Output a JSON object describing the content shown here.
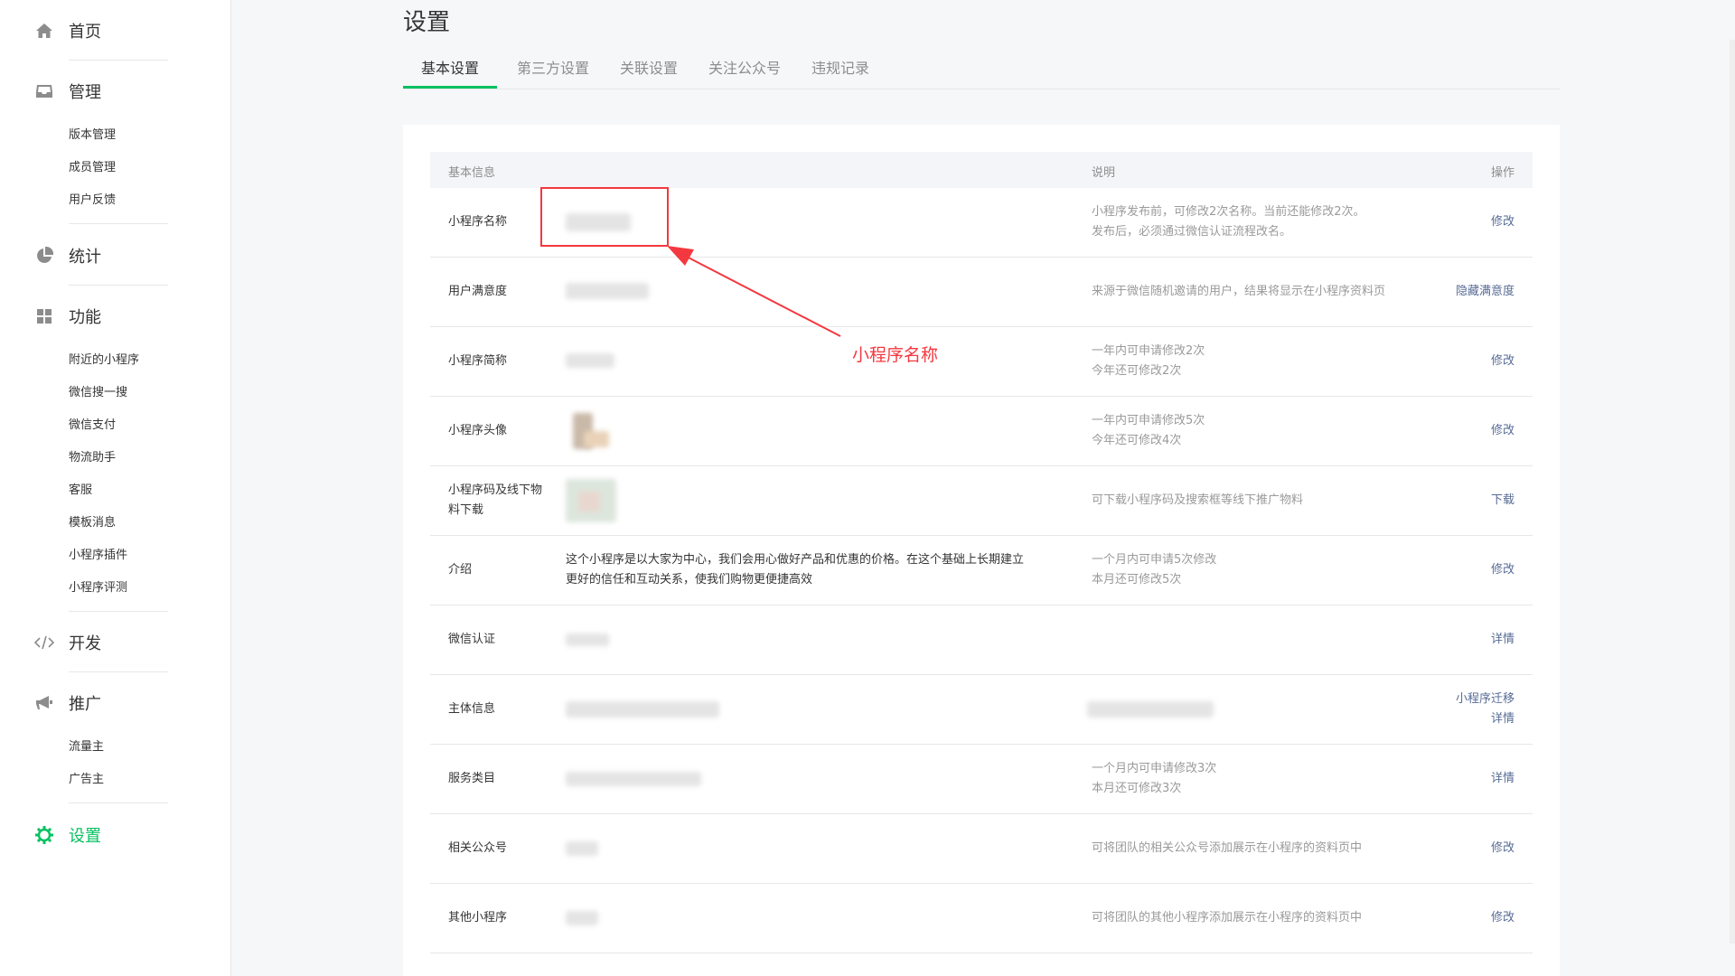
{
  "sidebar": {
    "home": "首页",
    "manage": "管理",
    "manage_items": [
      "版本管理",
      "成员管理",
      "用户反馈"
    ],
    "stats": "统计",
    "features": "功能",
    "feature_items": [
      "附近的小程序",
      "微信搜一搜",
      "微信支付",
      "物流助手",
      "客服",
      "模板消息",
      "小程序插件",
      "小程序评测"
    ],
    "develop": "开发",
    "promote": "推广",
    "promote_items": [
      "流量主",
      "广告主"
    ],
    "settings": "设置"
  },
  "page": {
    "title": "设置",
    "tabs": [
      "基本设置",
      "第三方设置",
      "关联设置",
      "关注公众号",
      "违规记录"
    ]
  },
  "table": {
    "headers": {
      "info": "基本信息",
      "desc": "说明",
      "op": "操作"
    },
    "rows": [
      {
        "label": "小程序名称",
        "desc1": "小程序发布前，可修改2次名称。当前还能修改2次。",
        "desc2": "发布后，必须通过微信认证流程改名。",
        "op1": "修改"
      },
      {
        "label": "用户满意度",
        "desc1": "来源于微信随机邀请的用户，结果将显示在小程序资料页",
        "op1": "隐藏满意度"
      },
      {
        "label": "小程序简称",
        "desc1": "一年内可申请修改2次",
        "desc2": "今年还可修改2次",
        "op1": "修改"
      },
      {
        "label": "小程序头像",
        "desc1": "一年内可申请修改5次",
        "desc2": "今年还可修改4次",
        "op1": "修改"
      },
      {
        "label": "小程序码及线下物",
        "label2": "料下载",
        "desc1": "可下载小程序码及搜索框等线下推广物料",
        "op1": "下载"
      },
      {
        "label": "介绍",
        "value1": "这个小程序是以大家为中心，我们会用心做好产品和优惠的价格。在这个基础上长期建立",
        "value2": "更好的信任和互动关系，使我们购物更便捷高效",
        "desc1": "一个月内可申请5次修改",
        "desc2": "本月还可修改5次",
        "op1": "修改"
      },
      {
        "label": "微信认证",
        "op1": "详情"
      },
      {
        "label": "主体信息",
        "op1": "小程序迁移",
        "op2": "详情"
      },
      {
        "label": "服务类目",
        "desc1": "一个月内可申请修改3次",
        "desc2": "本月还可修改3次",
        "op1": "详情"
      },
      {
        "label": "相关公众号",
        "desc1": "可将团队的相关公众号添加展示在小程序的资料页中",
        "op1": "修改"
      },
      {
        "label": "其他小程序",
        "desc1": "可将团队的其他小程序添加展示在小程序的资料页中",
        "op1": "修改"
      }
    ]
  },
  "annotation": {
    "text": "小程序名称",
    "color": "#f4383f"
  },
  "colors": {
    "accent": "#07c160",
    "link": "#576b95"
  }
}
